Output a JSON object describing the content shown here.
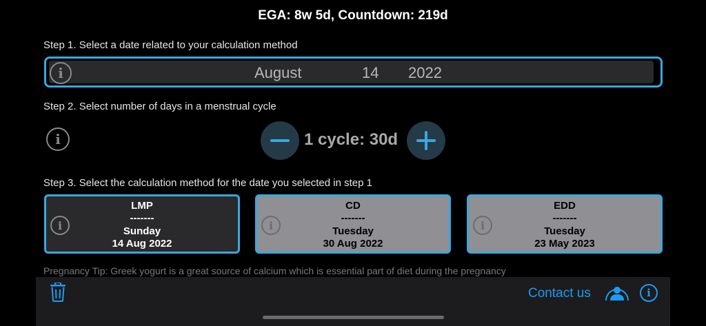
{
  "header": {
    "title": "EGA: 8w 5d, Countdown: 219d"
  },
  "step1": {
    "label": "Step 1. Select a date related to your calculation method",
    "month": "August",
    "day": "14",
    "year": "2022",
    "icon": "info-icon"
  },
  "step2": {
    "label": "Step 2. Select number of days in a menstrual cycle",
    "cycle_text": "1 cycle: 30d",
    "minus_icon": "minus-icon",
    "plus_icon": "plus-icon"
  },
  "step3": {
    "label": "Step 3. Select the calculation method for the date you selected in step 1",
    "cards": [
      {
        "title": "LMP",
        "divider": "-------",
        "weekday": "Sunday",
        "date": "14 Aug 2022",
        "selected": true
      },
      {
        "title": "CD",
        "divider": "-------",
        "weekday": "Tuesday",
        "date": "30 Aug 2022",
        "selected": false
      },
      {
        "title": "EDD",
        "divider": "-------",
        "weekday": "Tuesday",
        "date": "23 May 2023",
        "selected": false
      }
    ]
  },
  "tip": "Pregnancy Tip: Greek yogurt is a great source of calcium which is essential part of diet during the pregnancy",
  "toolbar": {
    "contact_label": "Contact us",
    "trash_icon": "trash-icon",
    "person_icon": "person-circle-icon",
    "info_icon": "info-icon"
  },
  "colors": {
    "accent": "#3aa7e0",
    "link": "#1e9bf0",
    "background": "#000000"
  }
}
